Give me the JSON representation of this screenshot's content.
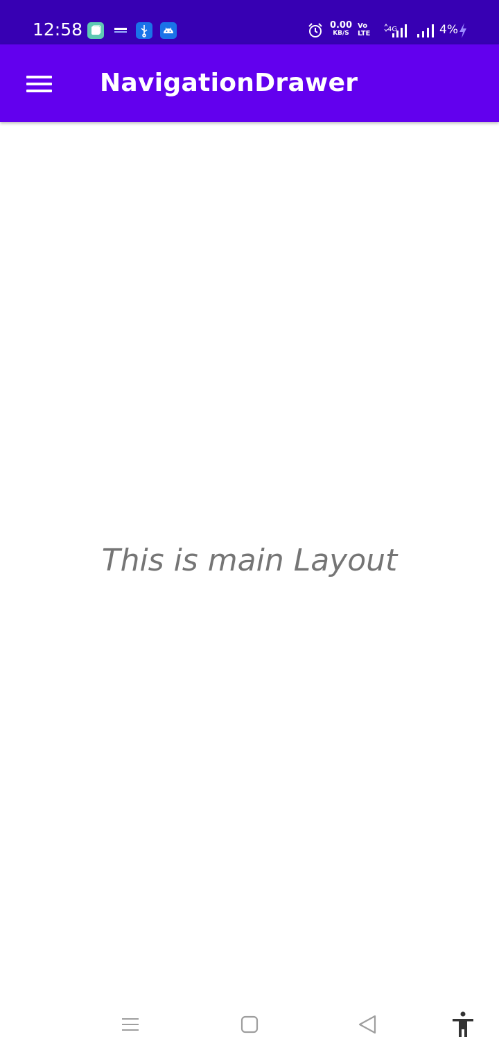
{
  "status_bar": {
    "time": "12:58",
    "net_speed_value": "0.00",
    "net_speed_unit": "KB/S",
    "volte_top": "Vo",
    "volte_bottom": "LTE",
    "battery_percent": "4%",
    "colors": {
      "background": "#3700b3"
    },
    "notification_icons": [
      "gallery-app-icon",
      "paytm-app-icon",
      "usb-debug-icon",
      "android-debug-icon"
    ],
    "system_icons": [
      "alarm-icon",
      "volte-icon",
      "4g-signal-icon",
      "signal-icon",
      "battery-charging-icon"
    ]
  },
  "app_bar": {
    "title": "NavigationDrawer",
    "menu_icon": "hamburger-menu-icon",
    "colors": {
      "background": "#6200ee",
      "text": "#ffffff"
    }
  },
  "main": {
    "text": "This is main Layout",
    "colors": {
      "text": "#757575"
    }
  },
  "nav_bar": {
    "buttons": [
      "recents-icon",
      "home-icon",
      "back-icon",
      "accessibility-icon"
    ]
  }
}
